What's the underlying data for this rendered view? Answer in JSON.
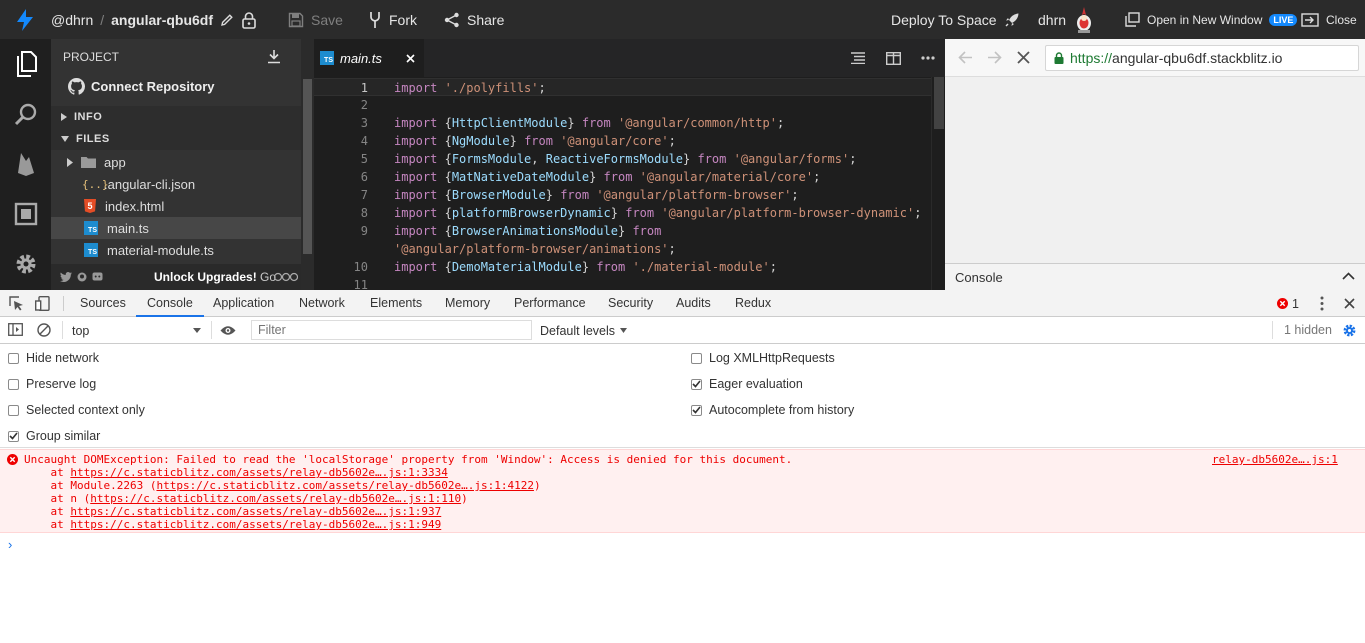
{
  "topbar": {
    "user": "@dhrn",
    "project": "angular-qbu6df",
    "save_label": "Save",
    "fork_label": "Fork",
    "share_label": "Share",
    "deploy_label": "Deploy To Space",
    "account_name": "dhrn",
    "open_window_label": "Open in New Window",
    "live_badge": "LIVE",
    "close_label": "Close"
  },
  "sidebar": {
    "project_heading": "PROJECT",
    "connect_repo": "Connect Repository",
    "info_section": "INFO",
    "files_section": "FILES",
    "files": [
      {
        "name": "app",
        "type": "folder"
      },
      {
        "name": ".angular-cli.json",
        "type": "json",
        "icon_text": "{..}"
      },
      {
        "name": "index.html",
        "type": "html",
        "icon_text": "5"
      },
      {
        "name": "main.ts",
        "type": "ts",
        "icon_text": "TS",
        "selected": true
      },
      {
        "name": "material-module.ts",
        "type": "ts",
        "icon_text": "TS"
      }
    ],
    "footer_upgrade": "Unlock Upgrades!",
    "footer_go": "Go"
  },
  "editor": {
    "tab_name": "main.ts",
    "tab_icon_text": "TS",
    "lines": [
      {
        "n": "1",
        "t": [
          [
            "k",
            "import "
          ],
          [
            "s",
            "'./polyfills'"
          ],
          [
            "p",
            ";"
          ]
        ]
      },
      {
        "n": "2",
        "t": []
      },
      {
        "n": "3",
        "t": [
          [
            "k",
            "import "
          ],
          [
            "p",
            "{"
          ],
          [
            "i",
            "HttpClientModule"
          ],
          [
            "p",
            "} "
          ],
          [
            "k",
            "from "
          ],
          [
            "s",
            "'@angular/common/http'"
          ],
          [
            "p",
            ";"
          ]
        ]
      },
      {
        "n": "4",
        "t": [
          [
            "k",
            "import "
          ],
          [
            "p",
            "{"
          ],
          [
            "i",
            "NgModule"
          ],
          [
            "p",
            "} "
          ],
          [
            "k",
            "from "
          ],
          [
            "s",
            "'@angular/core'"
          ],
          [
            "p",
            ";"
          ]
        ]
      },
      {
        "n": "5",
        "t": [
          [
            "k",
            "import "
          ],
          [
            "p",
            "{"
          ],
          [
            "i",
            "FormsModule"
          ],
          [
            "p",
            ", "
          ],
          [
            "i",
            "ReactiveFormsModule"
          ],
          [
            "p",
            "} "
          ],
          [
            "k",
            "from "
          ],
          [
            "s",
            "'@angular/forms'"
          ],
          [
            "p",
            ";"
          ]
        ]
      },
      {
        "n": "6",
        "t": [
          [
            "k",
            "import "
          ],
          [
            "p",
            "{"
          ],
          [
            "i",
            "MatNativeDateModule"
          ],
          [
            "p",
            "} "
          ],
          [
            "k",
            "from "
          ],
          [
            "s",
            "'@angular/material/core'"
          ],
          [
            "p",
            ";"
          ]
        ]
      },
      {
        "n": "7",
        "t": [
          [
            "k",
            "import "
          ],
          [
            "p",
            "{"
          ],
          [
            "i",
            "BrowserModule"
          ],
          [
            "p",
            "} "
          ],
          [
            "k",
            "from "
          ],
          [
            "s",
            "'@angular/platform-browser'"
          ],
          [
            "p",
            ";"
          ]
        ]
      },
      {
        "n": "8",
        "t": [
          [
            "k",
            "import "
          ],
          [
            "p",
            "{"
          ],
          [
            "i",
            "platformBrowserDynamic"
          ],
          [
            "p",
            "} "
          ],
          [
            "k",
            "from "
          ],
          [
            "s",
            "'@angular/platform-browser-dynamic'"
          ],
          [
            "p",
            ";"
          ]
        ]
      },
      {
        "n": "9",
        "t": [
          [
            "k",
            "import "
          ],
          [
            "p",
            "{"
          ],
          [
            "i",
            "BrowserAnimationsModule"
          ],
          [
            "p",
            "} "
          ],
          [
            "k",
            "from"
          ]
        ]
      },
      {
        "n": "",
        "t": [
          [
            "s",
            "'@angular/platform-browser/animations'"
          ],
          [
            "p",
            ";"
          ]
        ]
      },
      {
        "n": "10",
        "t": [
          [
            "k",
            "import "
          ],
          [
            "p",
            "{"
          ],
          [
            "i",
            "DemoMaterialModule"
          ],
          [
            "p",
            "} "
          ],
          [
            "k",
            "from "
          ],
          [
            "s",
            "'./material-module'"
          ],
          [
            "p",
            ";"
          ]
        ]
      },
      {
        "n": "11",
        "t": []
      }
    ]
  },
  "preview": {
    "url_scheme": "https://",
    "url_host": "angular-qbu6df.stackblitz.io",
    "console_label": "Console"
  },
  "devtools": {
    "tabs": [
      "Sources",
      "Console",
      "Application",
      "Network",
      "Elements",
      "Memory",
      "Performance",
      "Security",
      "Audits",
      "Redux"
    ],
    "selected_tab": "Console",
    "error_count": "1",
    "context": "top",
    "filter_placeholder": "Filter",
    "levels": "Default levels",
    "hidden_count": "1 hidden",
    "settings_left": [
      {
        "label": "Hide network",
        "checked": false
      },
      {
        "label": "Preserve log",
        "checked": false
      },
      {
        "label": "Selected context only",
        "checked": false
      },
      {
        "label": "Group similar",
        "checked": true
      }
    ],
    "settings_right": [
      {
        "label": "Log XMLHttpRequests",
        "checked": false
      },
      {
        "label": "Eager evaluation",
        "checked": true
      },
      {
        "label": "Autocomplete from history",
        "checked": true
      }
    ],
    "error": {
      "message": "Uncaught DOMException: Failed to read the 'localStorage' property from 'Window': Access is denied for this document.",
      "source": "relay-db5602e….js:1",
      "stack": [
        {
          "prefix": "    at ",
          "link": "https://c.staticblitz.com/assets/relay-db5602e….js:1:3334",
          "suffix": ""
        },
        {
          "prefix": "    at Module.2263 (",
          "link": "https://c.staticblitz.com/assets/relay-db5602e….js:1:4122",
          "suffix": ")"
        },
        {
          "prefix": "    at n (",
          "link": "https://c.staticblitz.com/assets/relay-db5602e….js:1:110",
          "suffix": ")"
        },
        {
          "prefix": "    at ",
          "link": "https://c.staticblitz.com/assets/relay-db5602e….js:1:937",
          "suffix": ""
        },
        {
          "prefix": "    at ",
          "link": "https://c.staticblitz.com/assets/relay-db5602e….js:1:949",
          "suffix": ""
        }
      ]
    },
    "prompt_symbol": "›"
  },
  "colors": {
    "accent": "#1389fd",
    "error_text": "#e00000",
    "error_bg": "#fff0f0",
    "devtools_tab_active": "#1a73e8"
  }
}
